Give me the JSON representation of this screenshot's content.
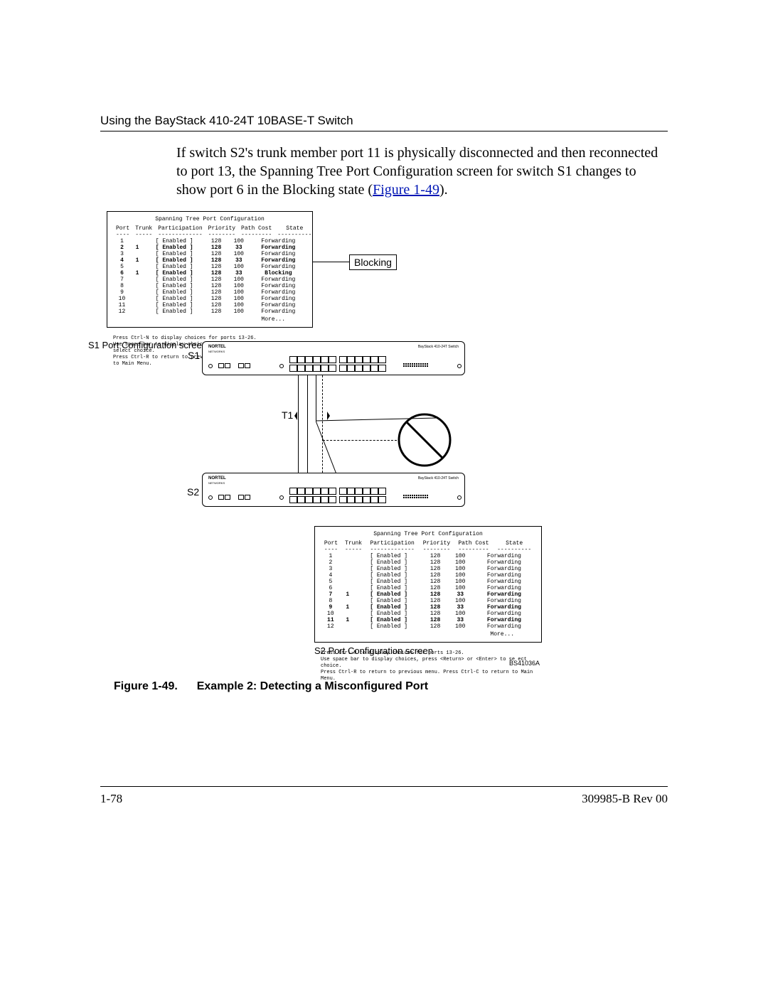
{
  "header": {
    "title": "Using the BayStack 410-24T 10BASE-T Switch"
  },
  "body": {
    "paragraph_prefix": "If switch S2's trunk member port 11 is physically disconnected and then reconnected to port 13, the Spanning Tree Port Configuration screen for switch S1 changes to show port 6 in the Blocking state (",
    "figure_link": "Figure 1-49",
    "paragraph_suffix": ")."
  },
  "s1": {
    "title": "Spanning Tree Port Configuration",
    "label": "S1 Port Configuration screen",
    "dev_label": "S1",
    "headers": {
      "port": "Port",
      "trunk": "Trunk",
      "participation": "Participation",
      "priority": "Priority",
      "pathcost": "Path Cost",
      "state": "State"
    },
    "underlines": {
      "port": "----",
      "trunk": "-----",
      "participation": "-------------",
      "priority": "--------",
      "pathcost": "---------",
      "state": "----------"
    },
    "rows": [
      {
        "port": "1",
        "trunk": "",
        "participation": "[ Enabled ]",
        "priority": "128",
        "pathcost": "100",
        "state": "Forwarding",
        "bold": false
      },
      {
        "port": "2",
        "trunk": "1",
        "participation": "[ Enabled ]",
        "priority": "128",
        "pathcost": "33",
        "state": "Forwarding",
        "bold": true
      },
      {
        "port": "3",
        "trunk": "",
        "participation": "[ Enabled ]",
        "priority": "128",
        "pathcost": "100",
        "state": "Forwarding",
        "bold": false
      },
      {
        "port": "4",
        "trunk": "1",
        "participation": "[ Enabled ]",
        "priority": "128",
        "pathcost": "33",
        "state": "Forwarding",
        "bold": true
      },
      {
        "port": "5",
        "trunk": "",
        "participation": "[ Enabled ]",
        "priority": "128",
        "pathcost": "100",
        "state": "Forwarding",
        "bold": false
      },
      {
        "port": "6",
        "trunk": "1",
        "participation": "[ Enabled ]",
        "priority": "128",
        "pathcost": "33",
        "state": "Blocking",
        "bold": true
      },
      {
        "port": "7",
        "trunk": "",
        "participation": "[ Enabled ]",
        "priority": "128",
        "pathcost": "100",
        "state": "Forwarding",
        "bold": false
      },
      {
        "port": "8",
        "trunk": "",
        "participation": "[ Enabled ]",
        "priority": "128",
        "pathcost": "100",
        "state": "Forwarding",
        "bold": false
      },
      {
        "port": "9",
        "trunk": "",
        "participation": "[ Enabled ]",
        "priority": "128",
        "pathcost": "100",
        "state": "Forwarding",
        "bold": false
      },
      {
        "port": "10",
        "trunk": "",
        "participation": "[ Enabled ]",
        "priority": "128",
        "pathcost": "100",
        "state": "Forwarding",
        "bold": false
      },
      {
        "port": "11",
        "trunk": "",
        "participation": "[ Enabled ]",
        "priority": "128",
        "pathcost": "100",
        "state": "Forwarding",
        "bold": false
      },
      {
        "port": "12",
        "trunk": "",
        "participation": "[ Enabled ]",
        "priority": "128",
        "pathcost": "100",
        "state": "Forwarding",
        "bold": false
      }
    ],
    "more": "More...",
    "instr1": "Press Ctrl-N to display choices for ports 13-26.",
    "instr2": "Use space bar to display choices, press <Return> or <Enter> to select choice.",
    "instr3": "Press Ctrl-R to return to previous menu.  Press Ctrl-C to return to Main Menu."
  },
  "s2": {
    "title": "Spanning Tree Port Configuration",
    "label": "S2 Port Configuration screen",
    "dev_label": "S2",
    "headers": {
      "port": "Port",
      "trunk": "Trunk",
      "participation": "Participation",
      "priority": "Priority",
      "pathcost": "Path Cost",
      "state": "State"
    },
    "underlines": {
      "port": "----",
      "trunk": "-----",
      "participation": "-------------",
      "priority": "--------",
      "pathcost": "---------",
      "state": "----------"
    },
    "rows": [
      {
        "port": "1",
        "trunk": "",
        "participation": "[ Enabled ]",
        "priority": "128",
        "pathcost": "100",
        "state": "Forwarding",
        "bold": false
      },
      {
        "port": "2",
        "trunk": "",
        "participation": "[ Enabled ]",
        "priority": "128",
        "pathcost": "100",
        "state": "Forwarding",
        "bold": false
      },
      {
        "port": "3",
        "trunk": "",
        "participation": "[ Enabled ]",
        "priority": "128",
        "pathcost": "100",
        "state": "Forwarding",
        "bold": false
      },
      {
        "port": "4",
        "trunk": "",
        "participation": "[ Enabled ]",
        "priority": "128",
        "pathcost": "100",
        "state": "Forwarding",
        "bold": false
      },
      {
        "port": "5",
        "trunk": "",
        "participation": "[ Enabled ]",
        "priority": "128",
        "pathcost": "100",
        "state": "Forwarding",
        "bold": false
      },
      {
        "port": "6",
        "trunk": "",
        "participation": "[ Enabled ]",
        "priority": "128",
        "pathcost": "100",
        "state": "Forwarding",
        "bold": false
      },
      {
        "port": "7",
        "trunk": "1",
        "participation": "[ Enabled ]",
        "priority": "128",
        "pathcost": "33",
        "state": "Forwarding",
        "bold": true
      },
      {
        "port": "8",
        "trunk": "",
        "participation": "[ Enabled ]",
        "priority": "128",
        "pathcost": "100",
        "state": "Forwarding",
        "bold": false
      },
      {
        "port": "9",
        "trunk": "1",
        "participation": "[ Enabled ]",
        "priority": "128",
        "pathcost": "33",
        "state": "Forwarding",
        "bold": true
      },
      {
        "port": "10",
        "trunk": "",
        "participation": "[ Enabled ]",
        "priority": "128",
        "pathcost": "100",
        "state": "Forwarding",
        "bold": false
      },
      {
        "port": "11",
        "trunk": "1",
        "participation": "[ Enabled ]",
        "priority": "128",
        "pathcost": "33",
        "state": "Forwarding",
        "bold": true
      },
      {
        "port": "12",
        "trunk": "",
        "participation": "[ Enabled ]",
        "priority": "128",
        "pathcost": "100",
        "state": "Forwarding",
        "bold": false
      }
    ],
    "more": "More...",
    "instr1": "Press Ctrl-N to display choices for ports 13-26.",
    "instr2": "Use space bar to display choices, press <Return> or <Enter> to se ect choice.",
    "instr3": "Press Ctrl-R to return to previous menu.  Press Ctrl-C to return to Main Menu."
  },
  "callout": {
    "blocking": "Blocking"
  },
  "trunk_label": "T1",
  "figure": {
    "label": "Figure 1-49.",
    "caption": "Example 2: Detecting a Misconfigured Port"
  },
  "code_id": "BS41036A",
  "footer": {
    "page": "1-78",
    "rev": "309985-B Rev 00"
  },
  "switch_labels": {
    "brand": "NORTEL",
    "brand_sub": "NETWORKS",
    "model": "BayStack 410-24T Switch"
  }
}
